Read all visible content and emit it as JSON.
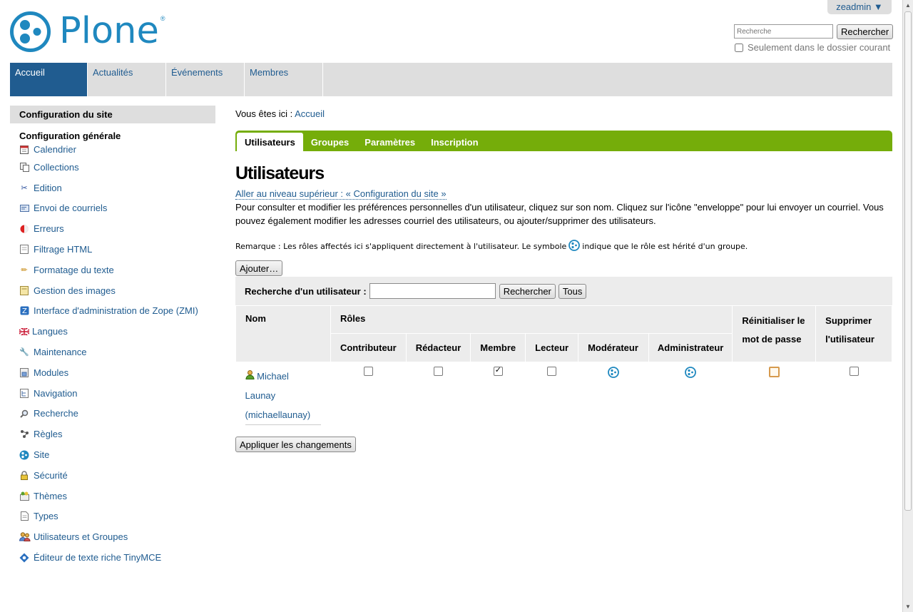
{
  "user_menu": {
    "label": "zeadmin ▼"
  },
  "logo": {
    "text": "Plone",
    "reg": "®"
  },
  "search": {
    "placeholder": "Recherche",
    "button": "Rechercher",
    "current_folder_label": "Seulement dans le dossier courant"
  },
  "portal_tabs": [
    {
      "label": "Accueil",
      "selected": true
    },
    {
      "label": "Actualités"
    },
    {
      "label": "Événements"
    },
    {
      "label": "Membres"
    }
  ],
  "sidebar": {
    "header": "Configuration du site",
    "section": "Configuration générale",
    "items": [
      {
        "label": "Calendrier",
        "icon": "calendar-icon"
      },
      {
        "label": "Collections",
        "icon": "collection-icon"
      },
      {
        "label": "Edition",
        "icon": "scissors-icon"
      },
      {
        "label": "Envoi de courriels",
        "icon": "mail-icon"
      },
      {
        "label": "Erreurs",
        "icon": "error-icon"
      },
      {
        "label": "Filtrage HTML",
        "icon": "filter-icon"
      },
      {
        "label": "Formatage du texte",
        "icon": "pencil-icon"
      },
      {
        "label": "Gestion des images",
        "icon": "image-icon"
      },
      {
        "label": "Interface d'administration de Zope (ZMI)",
        "icon": "zope-icon"
      },
      {
        "label": "Langues",
        "icon": "flag-icon"
      },
      {
        "label": "Maintenance",
        "icon": "wrench-icon"
      },
      {
        "label": "Modules",
        "icon": "module-icon"
      },
      {
        "label": "Navigation",
        "icon": "navigation-icon"
      },
      {
        "label": "Recherche",
        "icon": "search-icon"
      },
      {
        "label": "Règles",
        "icon": "rules-icon"
      },
      {
        "label": "Site",
        "icon": "plone-icon"
      },
      {
        "label": "Sécurité",
        "icon": "lock-icon"
      },
      {
        "label": "Thèmes",
        "icon": "theme-icon"
      },
      {
        "label": "Types",
        "icon": "document-icon"
      },
      {
        "label": "Utilisateurs et Groupes",
        "icon": "users-icon"
      },
      {
        "label": "Éditeur de texte riche TinyMCE",
        "icon": "tinymce-icon"
      }
    ]
  },
  "breadcrumb": {
    "prefix": "Vous êtes ici :",
    "home": "Accueil"
  },
  "content_tabs": [
    {
      "label": "Utilisateurs",
      "selected": true
    },
    {
      "label": "Groupes"
    },
    {
      "label": "Paramètres"
    },
    {
      "label": "Inscription"
    }
  ],
  "main": {
    "title": "Utilisateurs",
    "up_link": "Aller au niveau supérieur : « Configuration du site »",
    "description": "Pour consulter et modifier les préférences personnelles d'un utilisateur, cliquez sur son nom. Cliquez sur l'icône \"enveloppe\" pour lui envoyer un courriel. Vous pouvez également modifier les adresses courriel des utilisateurs, ou ajouter/supprimer des utilisateurs.",
    "note_before": "Remarque : Les rôles affectés ici s'appliquent directement à l'utilisateur. Le symbole",
    "note_after": "indique que le rôle est hérité d'un groupe.",
    "add_button": "Ajouter…",
    "user_search_label": "Recherche d'un utilisateur :",
    "user_search_value": "",
    "user_search_button": "Rechercher",
    "all_button": "Tous",
    "apply_button": "Appliquer les changements"
  },
  "table": {
    "col_name": "Nom",
    "col_roles": "Rôles",
    "col_reset": "Réinitialiser le mot de passe",
    "col_delete": "Supprimer l'utilisateur",
    "roles": [
      "Contributeur",
      "Rédacteur",
      "Membre",
      "Lecteur",
      "Modérateur",
      "Administrateur"
    ],
    "rows": [
      {
        "name": "Michael Launay",
        "login": "(michaellaunay)",
        "roles": [
          "unchecked",
          "unchecked",
          "checked",
          "unchecked",
          "inherited",
          "inherited"
        ],
        "reset": false,
        "delete": false
      }
    ]
  },
  "colors": {
    "brand_blue": "#1f88bf",
    "link_blue": "#205c90",
    "green_tabs": "#75ad0a",
    "tab_gray": "#dedede"
  }
}
